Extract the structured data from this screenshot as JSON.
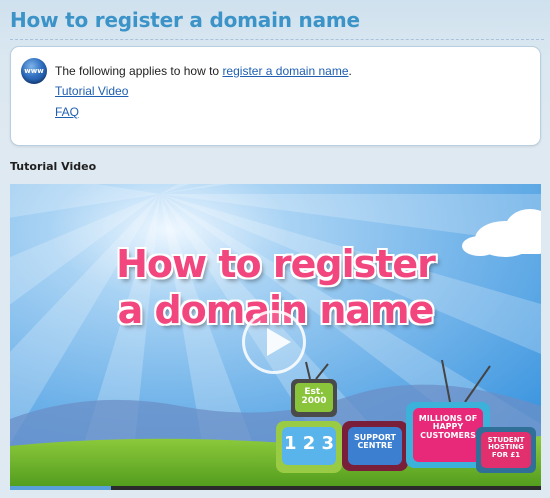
{
  "page": {
    "title": "How to register a domain name"
  },
  "info_box": {
    "icon": "www-globe-icon",
    "icon_text": "www",
    "intro_prefix": "The following applies to how to ",
    "intro_link": "register a domain name",
    "intro_suffix": ".",
    "links": [
      "Tutorial Video",
      "FAQ"
    ]
  },
  "section": {
    "heading": "Tutorial Video"
  },
  "video": {
    "caption_line1": "How to register",
    "caption_line2": "a domain name",
    "tv_est": "Est. 2000",
    "tv_123": "1 2 3",
    "tv_support": "SUPPORT CENTRE",
    "tv_millions": "MILLIONS OF HAPPY CUSTOMERS",
    "tv_student": "STUDENT HOSTING FOR £1",
    "progress_fraction": 0.19
  },
  "colors": {
    "title": "#3b93c8",
    "link": "#1f5fb0",
    "caption": "#f2467f",
    "sky": "#5aa8e6",
    "grass": "#6fb52c"
  }
}
